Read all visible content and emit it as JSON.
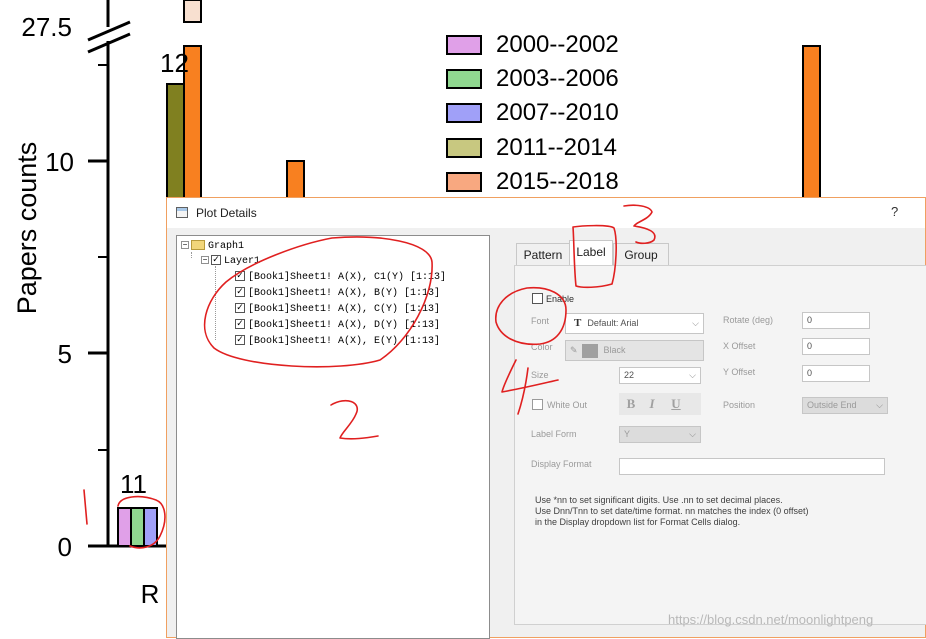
{
  "chart_data": {
    "type": "bar",
    "ylabel": "Papers counts",
    "y_ticks": [
      "0",
      "5",
      "10",
      "27.5"
    ],
    "x_tick_visible": "R",
    "legend": [
      "2000--2002",
      "2003--2006",
      "2007--2010",
      "2011--2014",
      "2015--2018"
    ],
    "legend_colors": [
      "#e0a0e8",
      "#90d890",
      "#a0a0f8",
      "#c8c880",
      "#f8a880"
    ],
    "data_labels": [
      "12",
      "11"
    ],
    "bars": [
      {
        "series": "2000--2002",
        "value": 1,
        "color": "#e0a0e8"
      },
      {
        "series": "2003--2006",
        "value": 1,
        "color": "#90d890"
      },
      {
        "series": "2007--2010",
        "value": 1,
        "color": "#a0a0f8"
      },
      {
        "series": "2011--2014",
        "value": 12,
        "color": "#808020"
      },
      {
        "series": "2015--2018",
        "value": 30,
        "color": "#f88020"
      },
      {
        "series": "2015--2018",
        "value": 10,
        "color": "#f88020"
      },
      {
        "series": "2015--2018",
        "value": 30,
        "color": "#f88020"
      }
    ]
  },
  "dialog": {
    "title": "Plot Details",
    "help": "?",
    "tree": {
      "graph": "Graph1",
      "layer": "Layer1",
      "items": [
        "[Book1]Sheet1! A(X), C1(Y) [1:13]",
        "[Book1]Sheet1! A(X), B(Y) [1:13]",
        "[Book1]Sheet1! A(X), C(Y) [1:13]",
        "[Book1]Sheet1! A(X), D(Y) [1:13]",
        "[Book1]Sheet1! A(X), E(Y) [1:13]"
      ]
    },
    "tabs": [
      "Pattern",
      "Label",
      "Group"
    ],
    "active_tab": "Label",
    "label": {
      "enable": "Enable",
      "font_label": "Font",
      "font_value": "Default: Arial",
      "color_label": "Color",
      "color_value": "Black",
      "size_label": "Size",
      "size_value": "22",
      "white_out": "White Out",
      "bold": "B",
      "italic": "I",
      "underline": "U",
      "label_form_label": "Label Form",
      "label_form_value": "Y",
      "display_format_label": "Display Format",
      "display_format_value": "",
      "rotate_label": "Rotate (deg)",
      "rotate_value": "0",
      "xoffset_label": "X Offset",
      "xoffset_value": "0",
      "yoffset_label": "Y Offset",
      "yoffset_value": "0",
      "position_label": "Position",
      "position_value": "Outside End",
      "help_lines": [
        "Use *nn to set significant digits. Use .nn to set decimal places.",
        "Use Dnn/Tnn to set date/time format. nn matches the index (0 offset)",
        "in the Display dropdown list for Format Cells dialog."
      ]
    }
  },
  "annotations": [
    "1",
    "2",
    "3",
    "4"
  ],
  "watermark": "https://blog.csdn.net/moonlightpeng"
}
